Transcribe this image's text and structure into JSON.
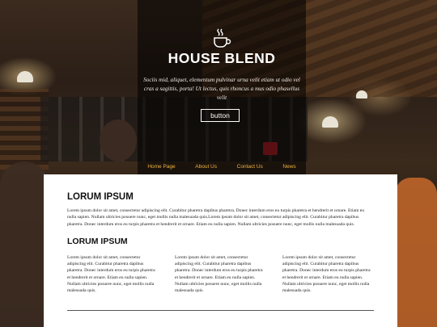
{
  "hero": {
    "title": "HOUSE BLEND",
    "description": "Sociis mid, aliquet, elementum pulvinar urna velit etiam ut odio vel cras a sagittis, porta! Ut lectus, quis rhoncus a mus odio phasellus velit",
    "button_label": "button",
    "icon": "coffee-cup-icon"
  },
  "nav": {
    "items": [
      "Home Page",
      "About Us",
      "Contact Us",
      "News"
    ],
    "color": "#f3b23f"
  },
  "content": {
    "section1": {
      "heading": "LORUM IPSUM",
      "body": "Lorem ipsum dolor sit amet, consectetur adipiscing elit. Curabitur pharetra dapibus pharetra. Donec interdum eros eu turpis pharetra et hendrerit et ornare. Etiam eu nulla sapien. Nullam ultricies posuere nunc, eget mollis nulla malesuada quis.Lorem ipsum dolor sit amet, consectetur adipiscing elit. Curabitur pharetra dapibus pharetra. Donec interdum eros eu turpis pharetra et hendrerit et ornare. Etiam eu nulla sapien. Nullam ultricies posuere nunc, eget mollis nulla malesuada quis."
    },
    "section2": {
      "heading": "LORUM IPSUM",
      "columns": [
        "Lorem ipsum dolor sit amet, consectetur adipiscing elit. Curabitur pharetra dapibus pharetra. Donec interdum eros eu turpis pharetra et hendrerit et ornare. Etiam eu nulla sapien. Nullam ultricies posuere nunc, eget mollis nulla malesuada quis.",
        "Lorem ipsum dolor sit amet, consectetur adipiscing elit. Curabitur pharetra dapibus pharetra. Donec interdum eros eu turpis pharetra et hendrerit et ornare. Etiam eu nulla sapien. Nullam ultricies posuere nunc, eget mollis nulla malesuada quis.",
        "Lorem ipsum dolor sit amet, consectetur adipiscing elit. Curabitur pharetra dapibus pharetra. Donec interdum eros eu turpis pharetra et hendrerit et ornare. Etiam eu nulla sapien. Nullam ultricies posuere nunc, eget mollis nulla malesuada quis."
      ]
    }
  }
}
